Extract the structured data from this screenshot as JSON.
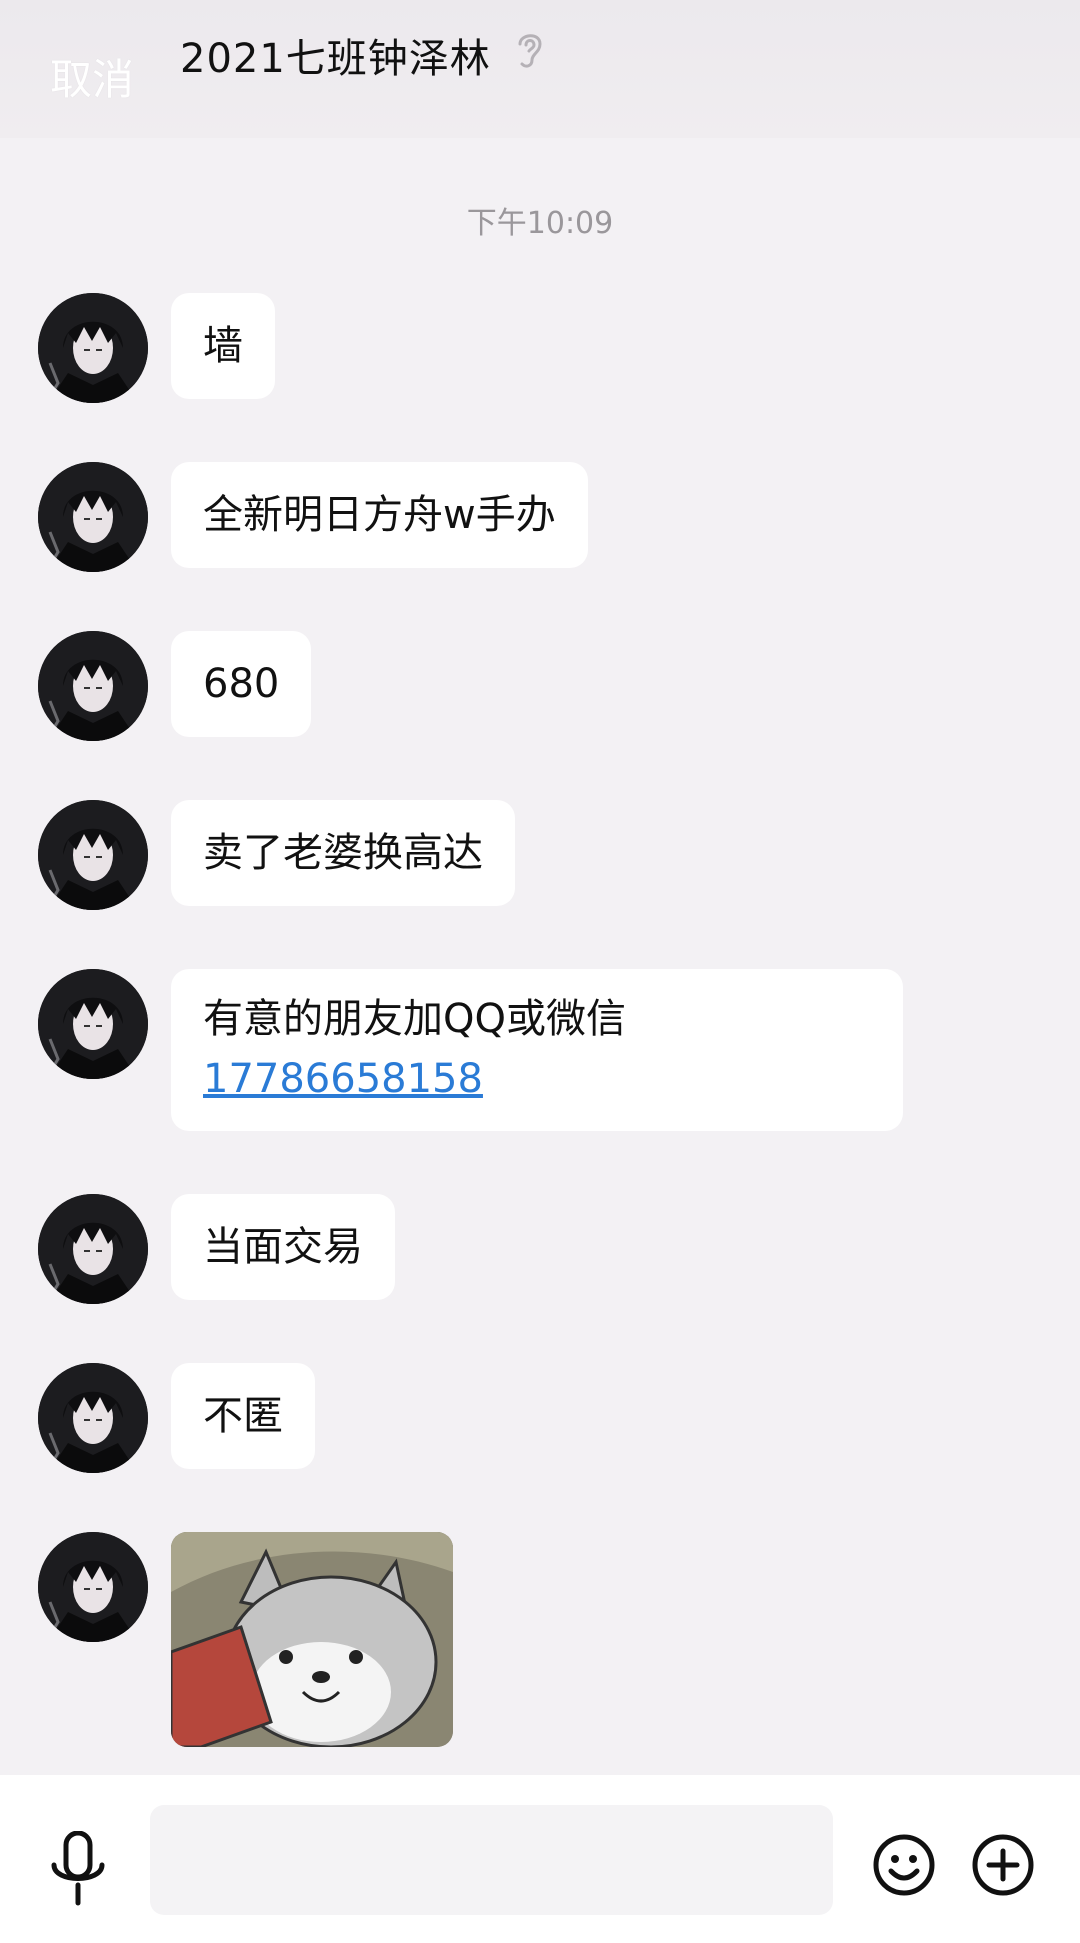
{
  "header": {
    "cancel_label": "取消",
    "title": "2021七班钟泽林",
    "ear_icon": "ear-icon"
  },
  "timestamp": "下午10:09",
  "messages": [
    {
      "type": "text",
      "text": "墙"
    },
    {
      "type": "text",
      "text": "全新明日方舟w手办"
    },
    {
      "type": "text",
      "text": "680"
    },
    {
      "type": "text",
      "text": "卖了老婆换高达"
    },
    {
      "type": "text",
      "line1": "有意的朋友加QQ或微信",
      "phone": "17786658158"
    },
    {
      "type": "text",
      "text": "当面交易"
    },
    {
      "type": "text",
      "text": "不匿"
    },
    {
      "type": "image",
      "description": "dog-sticker"
    }
  ],
  "input_bar": {
    "voice_icon": "microphone-icon",
    "text_value": "",
    "emoji_icon": "smiley-icon",
    "more_icon": "plus-circle-icon"
  },
  "colors": {
    "background": "#f3f1f4",
    "bubble": "#ffffff",
    "link": "#2a7bd6"
  }
}
